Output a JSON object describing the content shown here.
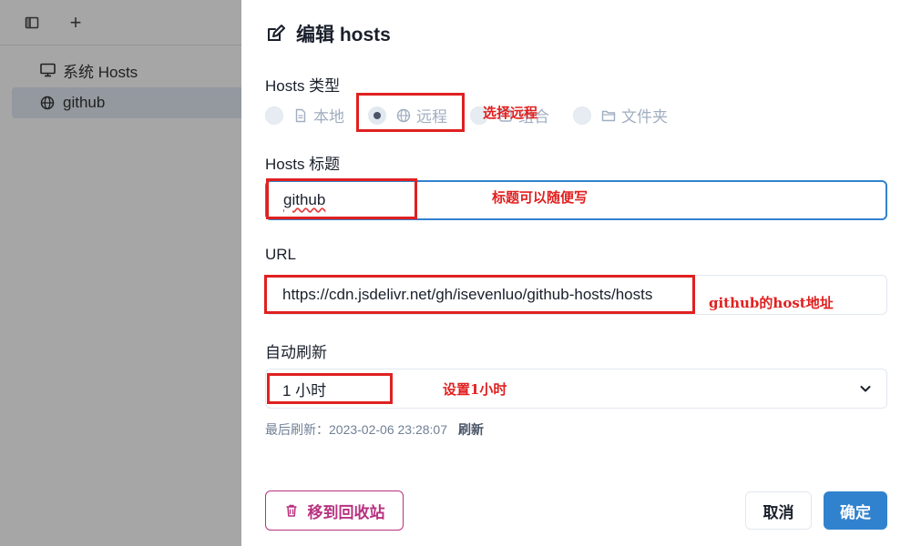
{
  "sidebar": {
    "toolbar": {
      "layout_icon": "layout-icon",
      "add_label": "+"
    },
    "items": [
      {
        "label": "系统 Hosts",
        "icon": "monitor-icon"
      },
      {
        "label": "github",
        "icon": "globe-icon"
      }
    ]
  },
  "panel": {
    "title": "编辑 hosts",
    "type": {
      "label": "Hosts 类型",
      "options": [
        {
          "label": "本地",
          "icon": "file-icon",
          "checked": false
        },
        {
          "label": "远程",
          "icon": "globe-icon",
          "checked": true
        },
        {
          "label": "组合",
          "icon": "group-icon",
          "checked": false
        },
        {
          "label": "文件夹",
          "icon": "folder-icon",
          "checked": false
        }
      ]
    },
    "title_field": {
      "label": "Hosts 标题",
      "value": "github"
    },
    "url_field": {
      "label": "URL",
      "value": "https://cdn.jsdelivr.net/gh/isevenluo/github-hosts/hosts"
    },
    "refresh": {
      "label": "自动刷新",
      "value": "1 小时",
      "last_refresh": "最后刷新：2023-02-06 23:28:07",
      "refresh_link": "刷新"
    },
    "buttons": {
      "trash": "移到回收站",
      "cancel": "取消",
      "ok": "确定"
    }
  },
  "annotations": {
    "remote": "选择远程",
    "title": "标题可以随便写",
    "url": "github的host地址",
    "refresh": "设置1小时"
  },
  "colors": {
    "accent": "#3182ce",
    "danger": "#b83280",
    "annotation": "#e02020"
  }
}
